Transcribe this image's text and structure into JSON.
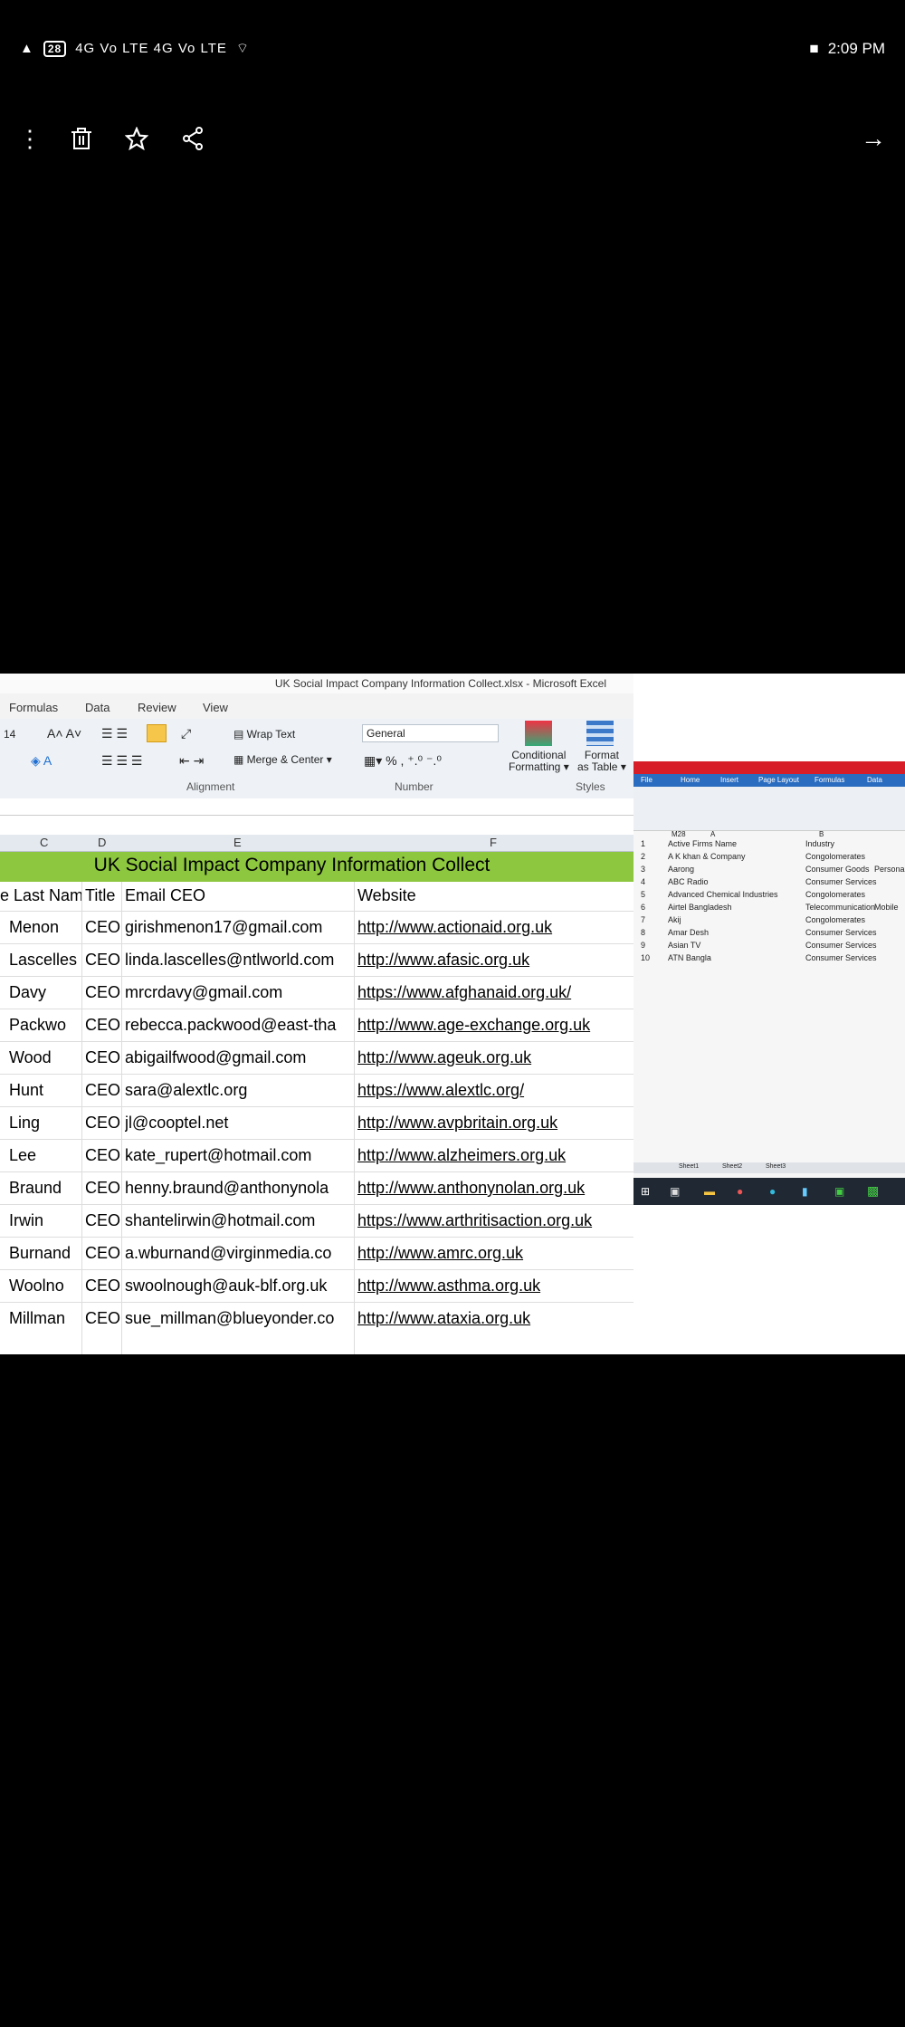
{
  "status": {
    "left_badge": "28",
    "network_text": "4G Vo LTE 4G Vo LTE",
    "time": "2:09 PM"
  },
  "toolbar": {
    "more": "⋮",
    "delete": "delete-icon",
    "favorite": "star-icon",
    "share": "share-icon",
    "forward": "→"
  },
  "excel": {
    "window_title": "UK Social Impact Company Information Collect.xlsx - Microsoft Excel",
    "tabs": [
      "Formulas",
      "Data",
      "Review",
      "View"
    ],
    "ribbon": {
      "font_size": "14",
      "wrap_text": "Wrap Text",
      "merge_center": "Merge & Center",
      "number_format": "General",
      "conditional": "Conditional",
      "conditional2": "Formatting",
      "format_table": "Format",
      "format_table2": "as Table",
      "group_alignment": "Alignment",
      "group_number": "Number",
      "group_styles": "Styles"
    },
    "columns": [
      "C",
      "D",
      "E",
      "F"
    ],
    "banner": "UK Social Impact Company Information Collect",
    "headers": {
      "last": "e Last Nam",
      "title": "Title",
      "email": "Email CEO",
      "web": "Website"
    },
    "rows": [
      {
        "last": "Menon",
        "title": "CEO",
        "email": "girishmenon17@gmail.com",
        "web": "http://www.actionaid.org.uk"
      },
      {
        "last": "Lascelles",
        "title": "CEO",
        "email": "linda.lascelles@ntlworld.com",
        "web": "http://www.afasic.org.uk"
      },
      {
        "last": "Davy",
        "title": "CEO",
        "email": "mrcrdavy@gmail.com",
        "web": "https://www.afghanaid.org.uk/"
      },
      {
        "last": "Packwo",
        "title": "CEO",
        "email": "rebecca.packwood@east-tha",
        "web": "http://www.age-exchange.org.uk"
      },
      {
        "last": "Wood",
        "title": "CEO",
        "email": "abigailfwood@gmail.com",
        "web": "http://www.ageuk.org.uk"
      },
      {
        "last": "Hunt",
        "title": "CEO",
        "email": "sara@alextlc.org",
        "web": "https://www.alextlc.org/"
      },
      {
        "last": "Ling",
        "title": "CEO",
        "email": "jl@cooptel.net",
        "web": "http://www.avpbritain.org.uk"
      },
      {
        "last": "Lee",
        "title": "CEO",
        "email": "kate_rupert@hotmail.com",
        "web": "http://www.alzheimers.org.uk"
      },
      {
        "last": "Braund",
        "title": "CEO",
        "email": "henny.braund@anthonynola",
        "web": "http://www.anthonynolan.org.uk"
      },
      {
        "last": "Irwin",
        "title": "CEO",
        "email": "shantelirwin@hotmail.com",
        "web": "https://www.arthritisaction.org.uk"
      },
      {
        "last": "Burnand",
        "title": "CEO",
        "email": "a.wburnand@virginmedia.co",
        "web": "http://www.amrc.org.uk"
      },
      {
        "last": "Woolno",
        "title": "CEO",
        "email": "swoolnough@auk-blf.org.uk",
        "web": "http://www.asthma.org.uk"
      },
      {
        "last": "Millman",
        "title": "CEO",
        "email": "sue_millman@blueyonder.co",
        "web": "http://www.ataxia.org.uk"
      }
    ]
  },
  "laptop": {
    "tabs": [
      "File",
      "Home",
      "Insert",
      "Page Layout",
      "Formulas",
      "Data"
    ],
    "name_box": "M28",
    "col_a": "A",
    "col_b": "B",
    "rows": [
      {
        "n": "1",
        "a": "Active Firms Name",
        "b": "Industry",
        "c": ""
      },
      {
        "n": "2",
        "a": "A K khan & Company",
        "b": "Congolomerates",
        "c": ""
      },
      {
        "n": "3",
        "a": "Aarong",
        "b": "Consumer Goods",
        "c": "Personal"
      },
      {
        "n": "4",
        "a": "ABC Radio",
        "b": "Consumer Services",
        "c": ""
      },
      {
        "n": "5",
        "a": "Advanced Chemical Industries",
        "b": "Congolomerates",
        "c": ""
      },
      {
        "n": "6",
        "a": "Airtel Bangladesh",
        "b": "Telecommunication",
        "c": "Mobile"
      },
      {
        "n": "7",
        "a": "Akij",
        "b": "Congolomerates",
        "c": ""
      },
      {
        "n": "8",
        "a": "Amar Desh",
        "b": "Consumer Services",
        "c": ""
      },
      {
        "n": "9",
        "a": "Asian TV",
        "b": "Consumer Services",
        "c": ""
      },
      {
        "n": "10",
        "a": "ATN Bangla",
        "b": "Consumer Services",
        "c": ""
      }
    ],
    "sheets": [
      "Sheet1",
      "Sheet2",
      "Sheet3"
    ]
  }
}
